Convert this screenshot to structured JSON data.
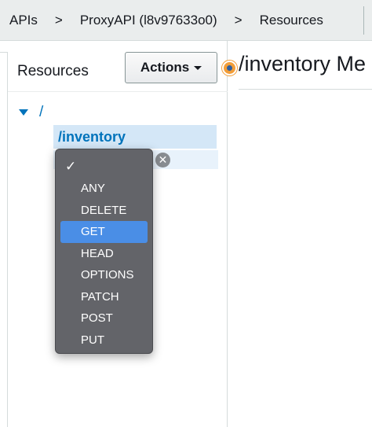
{
  "breadcrumb": {
    "items": [
      "APIs",
      "ProxyAPI (l8v97633o0)",
      "Resources"
    ],
    "separator": ">"
  },
  "left_panel": {
    "title": "Resources",
    "actions_label": "Actions"
  },
  "tree": {
    "root": "/",
    "child": "/inventory"
  },
  "method_dropdown": {
    "check_mark": "✓",
    "options": [
      "ANY",
      "DELETE",
      "GET",
      "HEAD",
      "OPTIONS",
      "PATCH",
      "POST",
      "PUT"
    ],
    "selected": "GET"
  },
  "main": {
    "heading": "/inventory Me"
  },
  "colors": {
    "link_blue": "#0073bb",
    "selected_row": "#d4e7f7",
    "dropdown_bg": "#636469",
    "dropdown_highlight": "#4a8ee6",
    "indicator_orange": "#f29d38"
  },
  "icons": {
    "tree_toggle": "triangle-down-icon",
    "cancel": "close-circle-icon",
    "actions_caret": "caret-down-icon"
  }
}
